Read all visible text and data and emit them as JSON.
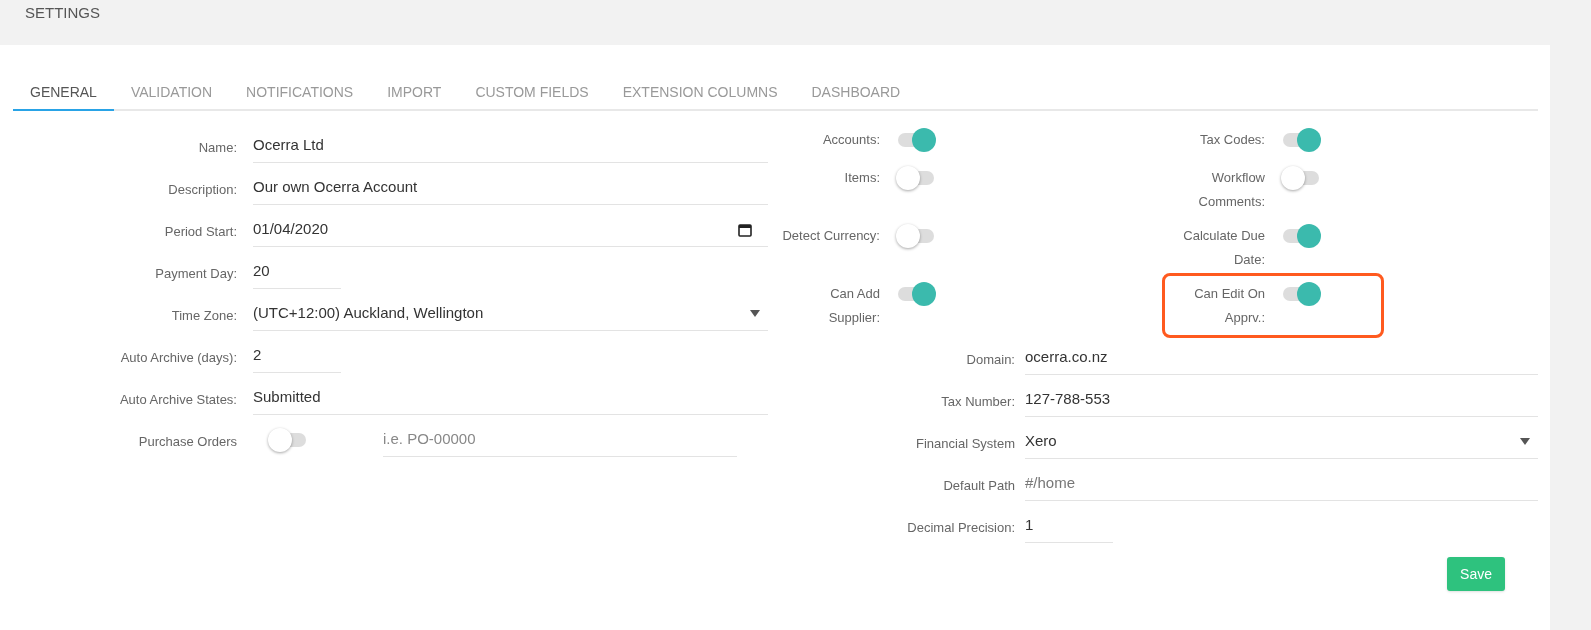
{
  "header": {
    "title": "SETTINGS"
  },
  "tabs": [
    {
      "label": "GENERAL",
      "selected": true
    },
    {
      "label": "VALIDATION",
      "selected": false
    },
    {
      "label": "NOTIFICATIONS",
      "selected": false
    },
    {
      "label": "IMPORT",
      "selected": false
    },
    {
      "label": "CUSTOM FIELDS",
      "selected": false
    },
    {
      "label": "EXTENSION COLUMNS",
      "selected": false
    },
    {
      "label": "DASHBOARD",
      "selected": false
    }
  ],
  "left_fields": [
    {
      "kind": "text",
      "label": "Name:",
      "value": "Ocerra Ltd"
    },
    {
      "kind": "text",
      "label": "Description:",
      "value": "Our own Ocerra Account"
    },
    {
      "kind": "date",
      "label": "Period Start:",
      "value": "01/04/2020"
    },
    {
      "kind": "short",
      "label": "Payment Day:",
      "value": "20"
    },
    {
      "kind": "select",
      "label": "Time Zone:",
      "value": "(UTC+12:00) Auckland, Wellington"
    },
    {
      "kind": "short",
      "label": "Auto Archive (days):",
      "value": "2"
    },
    {
      "kind": "text",
      "label": "Auto Archive States:",
      "value": "Submitted"
    },
    {
      "kind": "toggle_input",
      "label": "Purchase Orders",
      "on": false,
      "placeholder": "i.e. PO-00000"
    }
  ],
  "toggles": [
    {
      "label": "Accounts:",
      "on": true,
      "highlighted": false
    },
    {
      "label": "Tax Codes:",
      "on": true,
      "highlighted": false
    },
    {
      "label": "Items:",
      "on": false,
      "highlighted": false
    },
    {
      "label": "Workflow Comments:",
      "on": false,
      "highlighted": false
    },
    {
      "label": "Detect Currency:",
      "on": false,
      "highlighted": false
    },
    {
      "label": "Calculate Due Date:",
      "on": true,
      "highlighted": false
    },
    {
      "label": "Can Add Supplier:",
      "on": true,
      "highlighted": false
    },
    {
      "label": "Can Edit On Apprv.:",
      "on": true,
      "highlighted": true
    }
  ],
  "right_fields": [
    {
      "kind": "text",
      "label": "Domain:",
      "value": "ocerra.co.nz"
    },
    {
      "kind": "text",
      "label": "Tax Number:",
      "value": "127-788-553"
    },
    {
      "kind": "select",
      "label": "Financial System",
      "value": "Xero"
    },
    {
      "kind": "text",
      "label": "Default Path",
      "placeholder": "#/home"
    },
    {
      "kind": "short",
      "label": "Decimal Precision:",
      "value": "1"
    }
  ],
  "save_button": "Save"
}
